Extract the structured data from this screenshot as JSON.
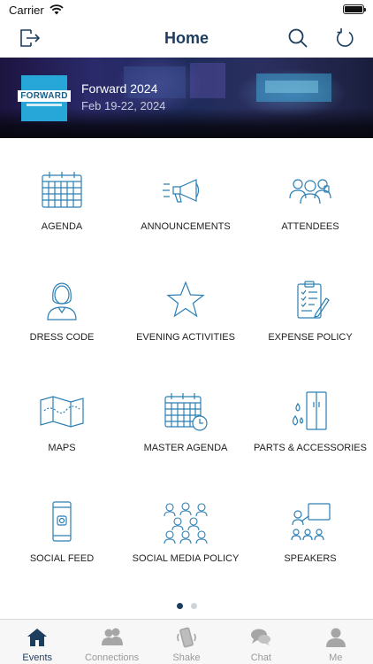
{
  "status_bar": {
    "carrier": "Carrier"
  },
  "nav": {
    "title": "Home"
  },
  "banner": {
    "logo_text": "FORWARD",
    "event_name": "Forward 2024",
    "event_dates": "Feb 19-22, 2024"
  },
  "tiles": [
    {
      "label": "AGENDA",
      "icon": "calendar-icon"
    },
    {
      "label": "ANNOUNCEMENTS",
      "icon": "megaphone-icon"
    },
    {
      "label": "ATTENDEES",
      "icon": "people-group-icon"
    },
    {
      "label": "DRESS CODE",
      "icon": "person-icon"
    },
    {
      "label": "EVENING ACTIVITIES",
      "icon": "star-icon"
    },
    {
      "label": "EXPENSE POLICY",
      "icon": "clipboard-pen-icon"
    },
    {
      "label": "MAPS",
      "icon": "map-icon"
    },
    {
      "label": "MASTER AGENDA",
      "icon": "calendar-clock-icon"
    },
    {
      "label": "PARTS & ACCESSORIES",
      "icon": "refrigerator-icon"
    },
    {
      "label": "SOCIAL FEED",
      "icon": "phone-camera-icon"
    },
    {
      "label": "SOCIAL MEDIA POLICY",
      "icon": "crowd-icon"
    },
    {
      "label": "SPEAKERS",
      "icon": "presenter-icon"
    }
  ],
  "pagination": {
    "pages": 2,
    "current": 1
  },
  "tab_bar": {
    "items": [
      {
        "label": "Events",
        "icon": "house-icon",
        "active": true
      },
      {
        "label": "Connections",
        "icon": "connections-icon",
        "active": false
      },
      {
        "label": "Shake",
        "icon": "shake-phone-icon",
        "active": false
      },
      {
        "label": "Chat",
        "icon": "chat-bubbles-icon",
        "active": false
      },
      {
        "label": "Me",
        "icon": "person-silhouette-icon",
        "active": false
      }
    ]
  },
  "colors": {
    "primary": "#1c3d5e",
    "icon_line": "#2b7fb5",
    "tab_inactive": "#9a9a9a"
  }
}
